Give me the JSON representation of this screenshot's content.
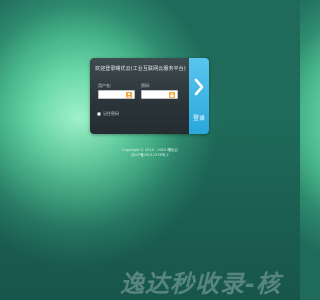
{
  "login": {
    "title": "欢迎登录曙优云(工业互联网云服务平台)",
    "username_label": "用户名:",
    "password_label": "密码:",
    "username_value": "",
    "password_value": "",
    "remember_label": "记住密码",
    "submit_label": "登录",
    "username_icon": "user-icon",
    "password_icon": "lock-icon",
    "accent_color": "#2aa7dc"
  },
  "footer": {
    "copyright": "Copyright © 2019 - 2020 曙优云",
    "icp": "浙ICP备19012378号-2"
  },
  "watermark": {
    "text": "逸达秒收录-核"
  }
}
